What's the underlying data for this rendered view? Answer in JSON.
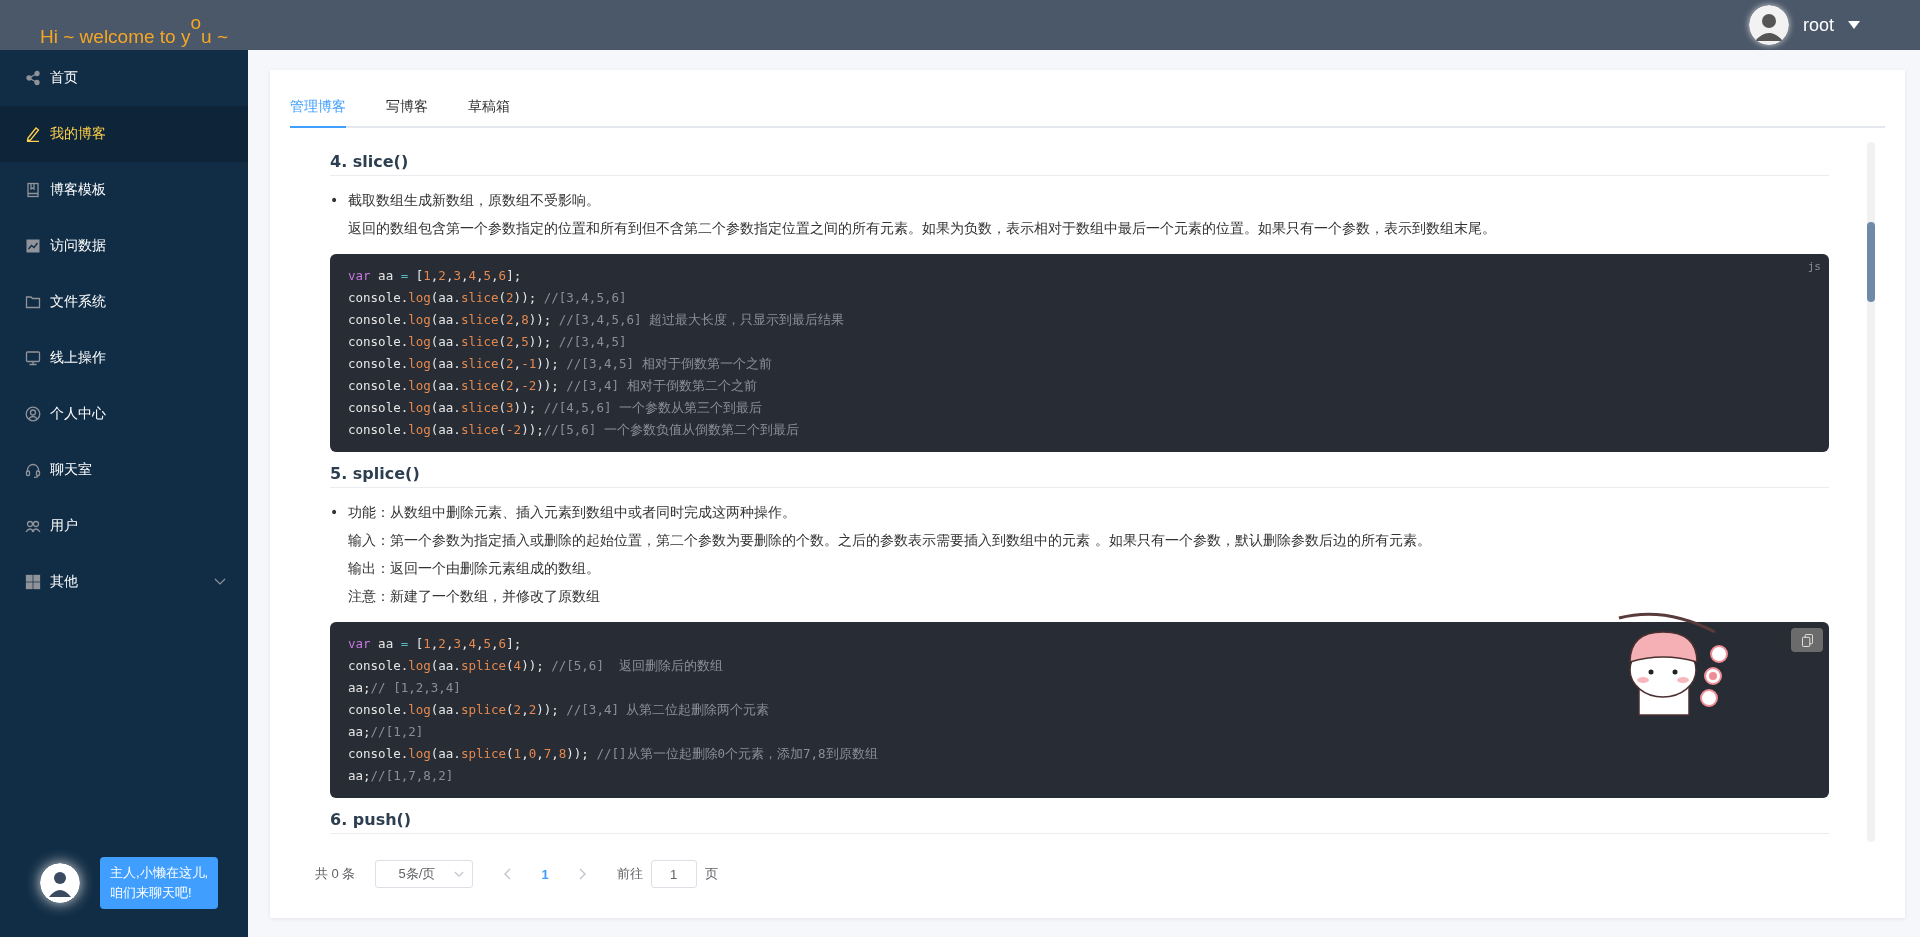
{
  "header": {
    "title": "Hi ~ welcome to y$^{o}$u ~",
    "user": {
      "name": "root"
    }
  },
  "sidebar": {
    "items": [
      {
        "label": "首页",
        "kind": "item",
        "selected": false
      },
      {
        "label": "我的博客",
        "kind": "item",
        "selected": true
      },
      {
        "label": "博客模板",
        "kind": "item",
        "selected": false
      },
      {
        "label": "访问数据",
        "kind": "item",
        "selected": false
      },
      {
        "label": "文件系统",
        "kind": "item",
        "selected": false
      },
      {
        "label": "线上操作",
        "kind": "item",
        "selected": false
      },
      {
        "label": "个人中心",
        "kind": "item",
        "selected": false
      },
      {
        "label": "聊天室",
        "kind": "item",
        "selected": false
      },
      {
        "label": "用户",
        "kind": "item",
        "selected": false
      },
      {
        "label": "其他",
        "kind": "submenu",
        "selected": false
      }
    ],
    "chat_widget": {
      "lines": [
        "主人,小懒在这儿,",
        "咱们来聊天吧!"
      ]
    }
  },
  "tabs": [
    {
      "label": "管理博客",
      "selected": true
    },
    {
      "label": "写博客",
      "selected": false
    },
    {
      "label": "草稿箱",
      "selected": false
    }
  ],
  "sections": [
    {
      "title": "4. slice()",
      "marker": "•",
      "paragraphs": [
        "截取数组生成新数组，原数组不受影响。",
        "返回的数组包含第一个参数指定的位置和所有到但不含第二个参数指定位置之间的所有元素。如果为负数，表示相对于数组中最后一个元素的位置。如果只有一个参数，表示到数组末尾。"
      ],
      "code": {
        "corner": {
          "kind": "lang",
          "text": "js"
        },
        "lines": [
          [
            {
              "kind": "kw",
              "text": "var"
            },
            {
              "kind": "p",
              "text": " aa "
            },
            {
              "kind": "op",
              "text": "="
            },
            {
              "kind": "p",
              "text": " ["
            },
            {
              "kind": "n",
              "text": "1"
            },
            {
              "kind": "p",
              "text": ","
            },
            {
              "kind": "n",
              "text": "2"
            },
            {
              "kind": "p",
              "text": ","
            },
            {
              "kind": "n",
              "text": "3"
            },
            {
              "kind": "p",
              "text": ","
            },
            {
              "kind": "n",
              "text": "4"
            },
            {
              "kind": "p",
              "text": ","
            },
            {
              "kind": "n",
              "text": "5"
            },
            {
              "kind": "p",
              "text": ","
            },
            {
              "kind": "n",
              "text": "6"
            },
            {
              "kind": "p",
              "text": "];"
            }
          ],
          [
            {
              "kind": "p",
              "text": "console."
            },
            {
              "kind": "f",
              "text": "log"
            },
            {
              "kind": "p",
              "text": "(aa."
            },
            {
              "kind": "f",
              "text": "slice"
            },
            {
              "kind": "p",
              "text": "("
            },
            {
              "kind": "n",
              "text": "2"
            },
            {
              "kind": "p",
              "text": "));"
            },
            {
              "kind": "c",
              "text": " //[3,4,5,6]"
            }
          ],
          [
            {
              "kind": "p",
              "text": "console."
            },
            {
              "kind": "f",
              "text": "log"
            },
            {
              "kind": "p",
              "text": "(aa."
            },
            {
              "kind": "f",
              "text": "slice"
            },
            {
              "kind": "p",
              "text": "("
            },
            {
              "kind": "n",
              "text": "2"
            },
            {
              "kind": "p",
              "text": ","
            },
            {
              "kind": "n",
              "text": "8"
            },
            {
              "kind": "p",
              "text": "));"
            },
            {
              "kind": "c",
              "text": " //[3,4,5,6] 超过最大长度，只显示到最后结果"
            }
          ],
          [
            {
              "kind": "p",
              "text": "console."
            },
            {
              "kind": "f",
              "text": "log"
            },
            {
              "kind": "p",
              "text": "(aa."
            },
            {
              "kind": "f",
              "text": "slice"
            },
            {
              "kind": "p",
              "text": "("
            },
            {
              "kind": "n",
              "text": "2"
            },
            {
              "kind": "p",
              "text": ","
            },
            {
              "kind": "n",
              "text": "5"
            },
            {
              "kind": "p",
              "text": "));"
            },
            {
              "kind": "c",
              "text": " //[3,4,5]"
            }
          ],
          [
            {
              "kind": "p",
              "text": "console."
            },
            {
              "kind": "f",
              "text": "log"
            },
            {
              "kind": "p",
              "text": "(aa."
            },
            {
              "kind": "f",
              "text": "slice"
            },
            {
              "kind": "p",
              "text": "("
            },
            {
              "kind": "n",
              "text": "2"
            },
            {
              "kind": "p",
              "text": ","
            },
            {
              "kind": "n",
              "text": "-1"
            },
            {
              "kind": "p",
              "text": "));"
            },
            {
              "kind": "c",
              "text": " //[3,4,5] 相对于倒数第一个之前"
            }
          ],
          [
            {
              "kind": "p",
              "text": "console."
            },
            {
              "kind": "f",
              "text": "log"
            },
            {
              "kind": "p",
              "text": "(aa."
            },
            {
              "kind": "f",
              "text": "slice"
            },
            {
              "kind": "p",
              "text": "("
            },
            {
              "kind": "n",
              "text": "2"
            },
            {
              "kind": "p",
              "text": ","
            },
            {
              "kind": "n",
              "text": "-2"
            },
            {
              "kind": "p",
              "text": "));"
            },
            {
              "kind": "c",
              "text": " //[3,4] 相对于倒数第二个之前"
            }
          ],
          [
            {
              "kind": "p",
              "text": "console."
            },
            {
              "kind": "f",
              "text": "log"
            },
            {
              "kind": "p",
              "text": "(aa."
            },
            {
              "kind": "f",
              "text": "slice"
            },
            {
              "kind": "p",
              "text": "("
            },
            {
              "kind": "n",
              "text": "3"
            },
            {
              "kind": "p",
              "text": "));"
            },
            {
              "kind": "c",
              "text": " //[4,5,6] 一个参数从第三个到最后"
            }
          ],
          [
            {
              "kind": "p",
              "text": "console."
            },
            {
              "kind": "f",
              "text": "log"
            },
            {
              "kind": "p",
              "text": "(aa."
            },
            {
              "kind": "f",
              "text": "slice"
            },
            {
              "kind": "p",
              "text": "("
            },
            {
              "kind": "n",
              "text": "-2"
            },
            {
              "kind": "p",
              "text": "));"
            },
            {
              "kind": "c",
              "text": "//[5,6] 一个参数负值从倒数第二个到最后"
            }
          ]
        ]
      }
    },
    {
      "title": "5. splice()",
      "marker": "•",
      "paragraphs": [
        "功能：从数组中删除元素、插入元素到数组中或者同时完成这两种操作。",
        "输入：第一个参数为指定插入或删除的起始位置，第二个参数为要删除的个数。之后的参数表示需要插入到数组中的元素 。如果只有一个参数，默认删除参数后边的所有元素。",
        "输出：返回一个由删除元素组成的数组。",
        "注意：新建了一个数组，并修改了原数组"
      ],
      "code": {
        "corner": {
          "kind": "copy"
        },
        "lines": [
          [
            {
              "kind": "kw",
              "text": "var"
            },
            {
              "kind": "p",
              "text": " aa "
            },
            {
              "kind": "op",
              "text": "="
            },
            {
              "kind": "p",
              "text": " ["
            },
            {
              "kind": "n",
              "text": "1"
            },
            {
              "kind": "p",
              "text": ","
            },
            {
              "kind": "n",
              "text": "2"
            },
            {
              "kind": "p",
              "text": ","
            },
            {
              "kind": "n",
              "text": "3"
            },
            {
              "kind": "p",
              "text": ","
            },
            {
              "kind": "n",
              "text": "4"
            },
            {
              "kind": "p",
              "text": ","
            },
            {
              "kind": "n",
              "text": "5"
            },
            {
              "kind": "p",
              "text": ","
            },
            {
              "kind": "n",
              "text": "6"
            },
            {
              "kind": "p",
              "text": "];"
            }
          ],
          [
            {
              "kind": "p",
              "text": "console."
            },
            {
              "kind": "f",
              "text": "log"
            },
            {
              "kind": "p",
              "text": "(aa."
            },
            {
              "kind": "f",
              "text": "splice"
            },
            {
              "kind": "p",
              "text": "("
            },
            {
              "kind": "n",
              "text": "4"
            },
            {
              "kind": "p",
              "text": "));"
            },
            {
              "kind": "c",
              "text": " //[5,6]  返回删除后的数组"
            }
          ],
          [
            {
              "kind": "p",
              "text": "aa;"
            },
            {
              "kind": "c",
              "text": "// [1,2,3,4]"
            }
          ],
          [
            {
              "kind": "p",
              "text": "console."
            },
            {
              "kind": "f",
              "text": "log"
            },
            {
              "kind": "p",
              "text": "(aa."
            },
            {
              "kind": "f",
              "text": "splice"
            },
            {
              "kind": "p",
              "text": "("
            },
            {
              "kind": "n",
              "text": "2"
            },
            {
              "kind": "p",
              "text": ","
            },
            {
              "kind": "n",
              "text": "2"
            },
            {
              "kind": "p",
              "text": "));"
            },
            {
              "kind": "c",
              "text": " //[3,4] 从第二位起删除两个元素"
            }
          ],
          [
            {
              "kind": "p",
              "text": "aa;"
            },
            {
              "kind": "c",
              "text": "//[1,2]"
            }
          ],
          [
            {
              "kind": "p",
              "text": "console."
            },
            {
              "kind": "f",
              "text": "log"
            },
            {
              "kind": "p",
              "text": "(aa."
            },
            {
              "kind": "f",
              "text": "splice"
            },
            {
              "kind": "p",
              "text": "("
            },
            {
              "kind": "n",
              "text": "1"
            },
            {
              "kind": "p",
              "text": ","
            },
            {
              "kind": "n",
              "text": "0"
            },
            {
              "kind": "p",
              "text": ","
            },
            {
              "kind": "n",
              "text": "7"
            },
            {
              "kind": "p",
              "text": ","
            },
            {
              "kind": "n",
              "text": "8"
            },
            {
              "kind": "p",
              "text": "));"
            },
            {
              "kind": "c",
              "text": " //[]从第一位起删除0个元素，添加7,8到原数组"
            }
          ],
          [
            {
              "kind": "p",
              "text": "aa;"
            },
            {
              "kind": "c",
              "text": "//[1,7,8,2]"
            }
          ]
        ]
      }
    },
    {
      "title": "6. push()"
    }
  ],
  "pagination": {
    "total": "共 0 条",
    "page_size": "5条/页",
    "pages": [
      {
        "label": "1",
        "selected": true
      }
    ],
    "goto_label": "前往",
    "goto_value": "1",
    "goto_suffix": "页"
  }
}
